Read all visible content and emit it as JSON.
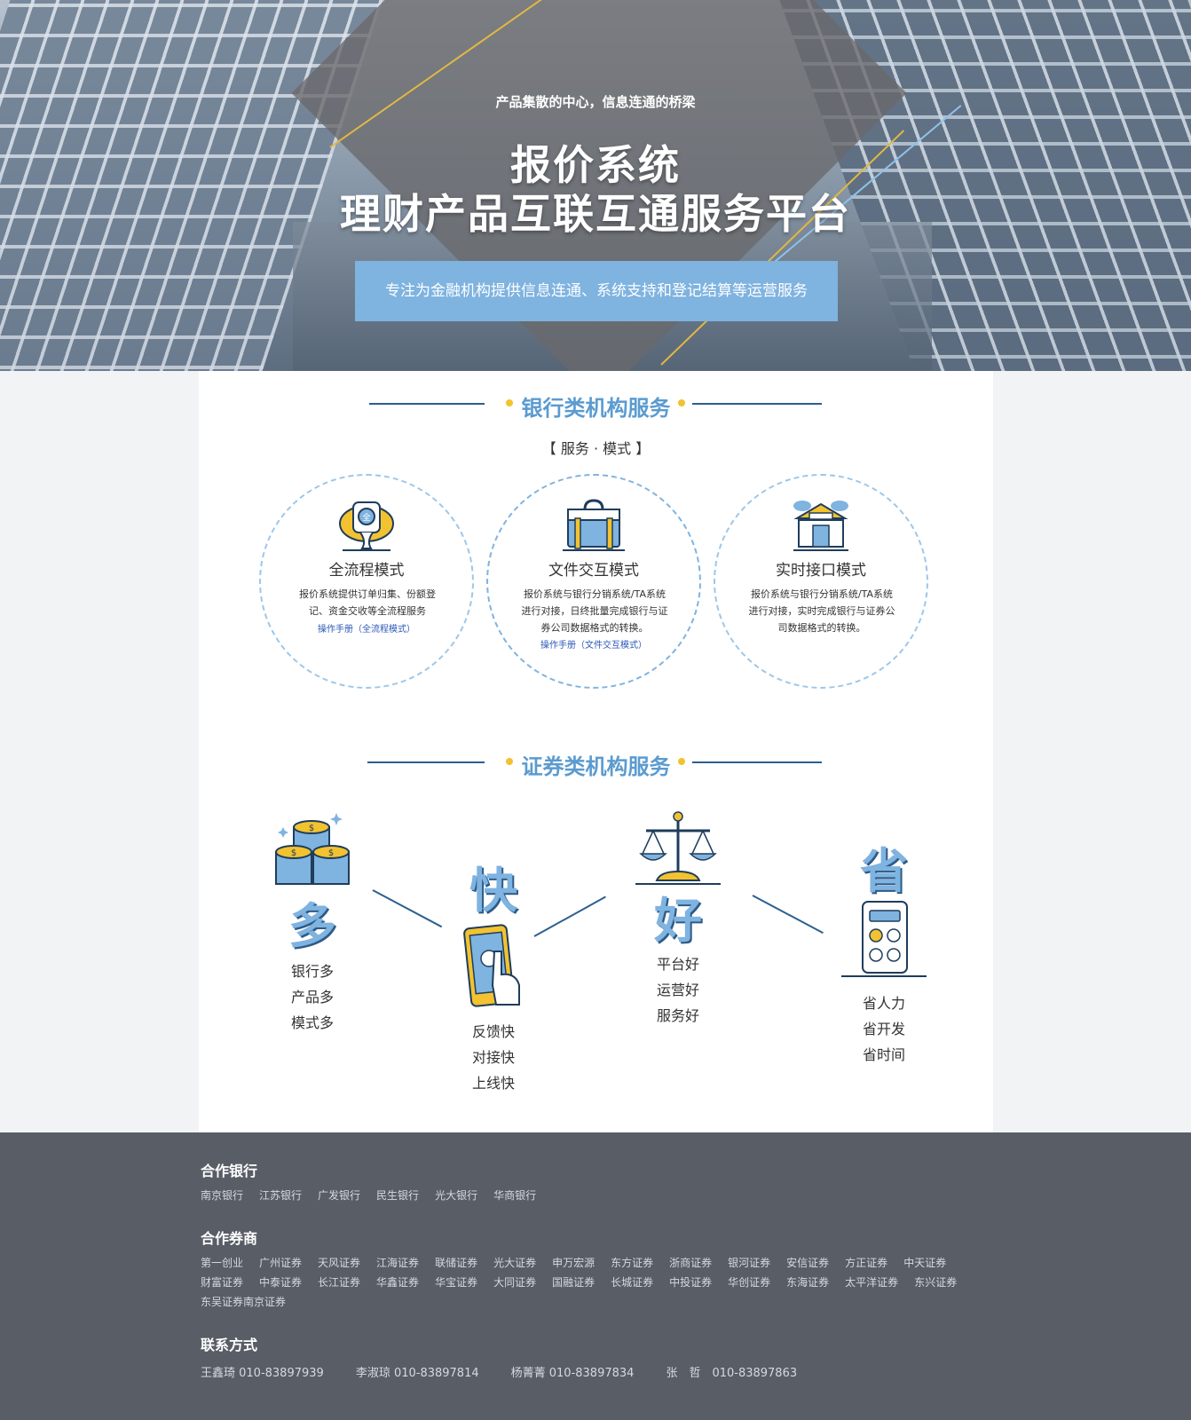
{
  "hero": {
    "slogan": "产品集散的中心，信息连通的桥梁",
    "title_line1": "报价系统",
    "title_line2": "理财产品互联互通服务平台",
    "tagline": "专注为金融机构提供信息连通、系统支持和登记结算等运营服务"
  },
  "bank_section": {
    "title": "银行类机构服务",
    "subtitle": "【 服务 · 模式 】",
    "modes": [
      {
        "title": "全流程模式",
        "desc": "报价系统提供订单归集、份额登记、资金交收等全流程服务",
        "link": "操作手册（全流程模式）",
        "icon": "trophy-coin-icon"
      },
      {
        "title": "文件交互模式",
        "desc": "报价系统与银行分销系统/TA系统进行对接，日终批量完成银行与证券公司数据格式的转换。",
        "link": "操作手册（文件交互模式）",
        "icon": "briefcase-icon"
      },
      {
        "title": "实时接口模式",
        "desc": "报价系统与银行分销系统/TA系统进行对接，实时完成银行与证券公司数据格式的转换。",
        "link": "",
        "icon": "bank-building-icon"
      }
    ]
  },
  "securities_section": {
    "title": "证券类机构服务",
    "features": [
      {
        "big": "多",
        "lines": [
          "银行多",
          "产品多",
          "模式多"
        ],
        "icon": "coins-stack-icon"
      },
      {
        "big": "快",
        "lines": [
          "反馈快",
          "对接快",
          "上线快"
        ],
        "icon": "phone-tap-icon"
      },
      {
        "big": "好",
        "lines": [
          "平台好",
          "运营好",
          "服务好"
        ],
        "icon": "scale-icon"
      },
      {
        "big": "省",
        "lines": [
          "省人力",
          "省开发",
          "省时间"
        ],
        "icon": "calculator-icon"
      }
    ]
  },
  "footer": {
    "banks_title": "合作银行",
    "banks": [
      "南京银行",
      "江苏银行",
      "广发银行",
      "民生银行",
      "光大银行",
      "华商银行"
    ],
    "brokers_title": "合作券商",
    "brokers_row1": [
      "第一创业",
      "广州证券",
      "天风证券",
      "江海证券",
      "联储证券",
      "光大证券",
      "申万宏源",
      "东方证券",
      "浙商证券",
      "银河证券",
      "安信证券",
      "方正证券",
      "中天证券"
    ],
    "brokers_row2": [
      "财富证券",
      "中泰证券",
      "长江证券",
      "华鑫证券",
      "华宝证券",
      "大同证券",
      "国融证券",
      "长城证券",
      "中投证券",
      "华创证券",
      "东海证券",
      "太平洋证券",
      "东兴证券"
    ],
    "brokers_row3": [
      "东吴证券南京证券"
    ],
    "contact_title": "联系方式",
    "contacts": [
      "王鑫琦 010-83897939",
      "李淑琼 010-83897814",
      "杨菁菁 010-83897834",
      "张　哲　010-83897863"
    ]
  },
  "colors": {
    "accent_blue": "#7fb3e0",
    "title_blue": "#5b9bd0",
    "line_navy": "#2c5f8e",
    "gold": "#f2c230",
    "footer_bg": "#585d66"
  }
}
